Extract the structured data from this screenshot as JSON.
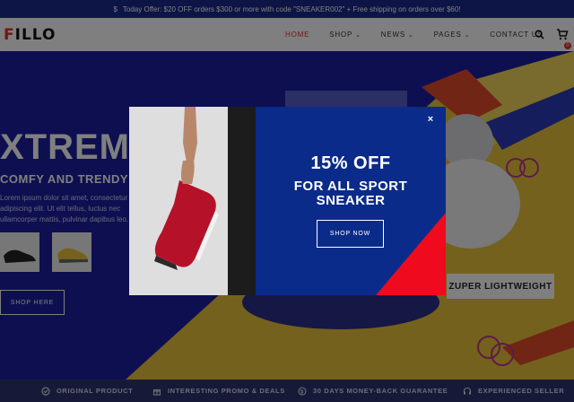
{
  "promo": {
    "icon": "dollar-icon",
    "text": "Today Offer: $20 OFF orders $300 or more with code \"SNEAKER002\" + Free shipping on orders over $60!"
  },
  "header": {
    "logo_first": "F",
    "logo_rest": "ILLO",
    "nav": [
      {
        "label": "HOME",
        "active": true,
        "dropdown": false
      },
      {
        "label": "SHOP",
        "active": false,
        "dropdown": true
      },
      {
        "label": "NEWS",
        "active": false,
        "dropdown": true
      },
      {
        "label": "PAGES",
        "active": false,
        "dropdown": true
      },
      {
        "label": "CONTACT US",
        "active": false,
        "dropdown": false
      }
    ],
    "cart_count": "0"
  },
  "hero": {
    "title": "XTREM",
    "subtitle": "COMFY AND TRENDY",
    "description": "Lorem ipsum dolor sit amet, consectetur adipiscing elit. Ut elit tellus, luctus nec ullamcorper mattis, pulvinar dapibus leo.",
    "button_label": "SHOP HERE",
    "shoe_label": "ZUPER LIGHTWEIGHT"
  },
  "modal": {
    "headline": "15% OFF",
    "subline_1": "FOR ALL SPORT",
    "subline_2": "SNEAKER",
    "button_label": "SHOP NOW",
    "close_label": "×"
  },
  "features": [
    {
      "icon": "check-circle-icon",
      "label": "ORIGINAL PRODUCT"
    },
    {
      "icon": "gift-icon",
      "label": "INTERESTING PROMO & DEALS"
    },
    {
      "icon": "money-back-icon",
      "label": "30 DAYS MONEY-BACK GUARANTEE"
    },
    {
      "icon": "headset-icon",
      "label": "EXPERIENCED SELLER"
    }
  ],
  "colors": {
    "accent": "#e22b2b",
    "modal_bg": "#0b2b8a",
    "hero_bg": "#1d1ea2"
  }
}
